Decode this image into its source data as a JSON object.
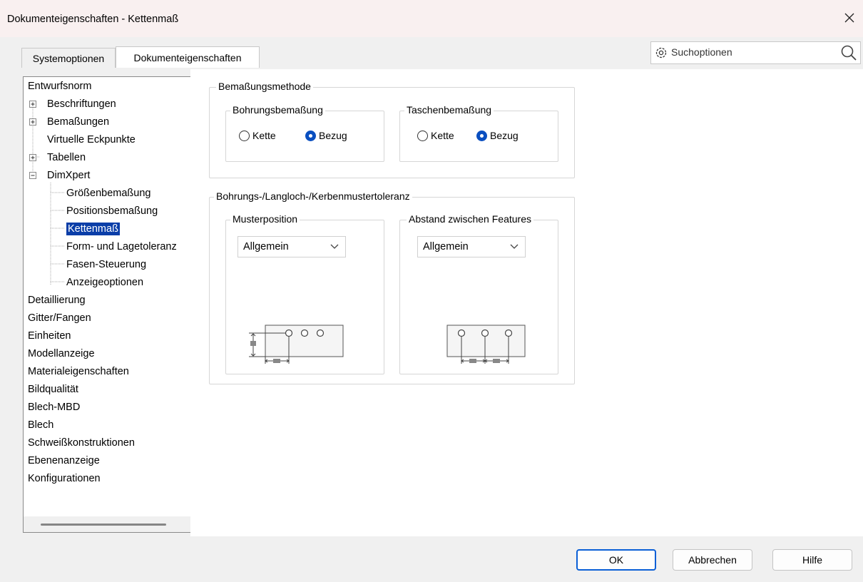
{
  "window": {
    "title": "Dokumenteigenschaften - Kettenmaß",
    "close_label": "×"
  },
  "tabs": [
    {
      "label": "Systemoptionen",
      "active": false
    },
    {
      "label": "Dokumenteigenschaften",
      "active": true
    }
  ],
  "search": {
    "placeholder": "Suchoptionen"
  },
  "tree": [
    {
      "label": "Entwurfsnorm",
      "level": 0
    },
    {
      "label": "Beschriftungen",
      "level": 1,
      "expander": "+"
    },
    {
      "label": "Bemaßungen",
      "level": 1,
      "expander": "+"
    },
    {
      "label": "Virtuelle Eckpunkte",
      "level": 1
    },
    {
      "label": "Tabellen",
      "level": 1,
      "expander": "+"
    },
    {
      "label": "DimXpert",
      "level": 1,
      "expander": "-"
    },
    {
      "label": "Größenbemaßung",
      "level": 2
    },
    {
      "label": "Positionsbemaßung",
      "level": 2
    },
    {
      "label": "Kettenmaß",
      "level": 2,
      "selected": true
    },
    {
      "label": "Form- und Lagetoleranz",
      "level": 2
    },
    {
      "label": "Fasen-Steuerung",
      "level": 2
    },
    {
      "label": "Anzeigeoptionen",
      "level": 2
    },
    {
      "label": "Detaillierung",
      "level": 0
    },
    {
      "label": "Gitter/Fangen",
      "level": 0
    },
    {
      "label": "Einheiten",
      "level": 0
    },
    {
      "label": "Modellanzeige",
      "level": 0
    },
    {
      "label": "Materialeigenschaften",
      "level": 0
    },
    {
      "label": "Bildqualität",
      "level": 0
    },
    {
      "label": "Blech-MBD",
      "level": 0
    },
    {
      "label": "Blech",
      "level": 0
    },
    {
      "label": "Schweißkonstruktionen",
      "level": 0
    },
    {
      "label": "Ebenenanzeige",
      "level": 0
    },
    {
      "label": "Konfigurationen",
      "level": 0
    }
  ],
  "method_group": {
    "title": "Bemaßungsmethode",
    "bohrung": {
      "title": "Bohrungsbemaßung",
      "option_chain": "Kette",
      "option_base": "Bezug",
      "selected": "Bezug"
    },
    "tasche": {
      "title": "Taschenbemaßung",
      "option_chain": "Kette",
      "option_base": "Bezug",
      "selected": "Bezug"
    }
  },
  "tolerance_group": {
    "title": "Bohrungs-/Langloch-/Kerbenmustertoleranz",
    "position": {
      "title": "Musterposition",
      "value": "Allgemein"
    },
    "spacing": {
      "title": "Abstand zwischen Features",
      "value": "Allgemein"
    }
  },
  "buttons": {
    "ok": "OK",
    "cancel": "Abbrechen",
    "help": "Hilfe"
  },
  "colors": {
    "accent": "#0a4fc0",
    "selection": "#0a3ea8",
    "titlebar": "#f9f0f0"
  }
}
